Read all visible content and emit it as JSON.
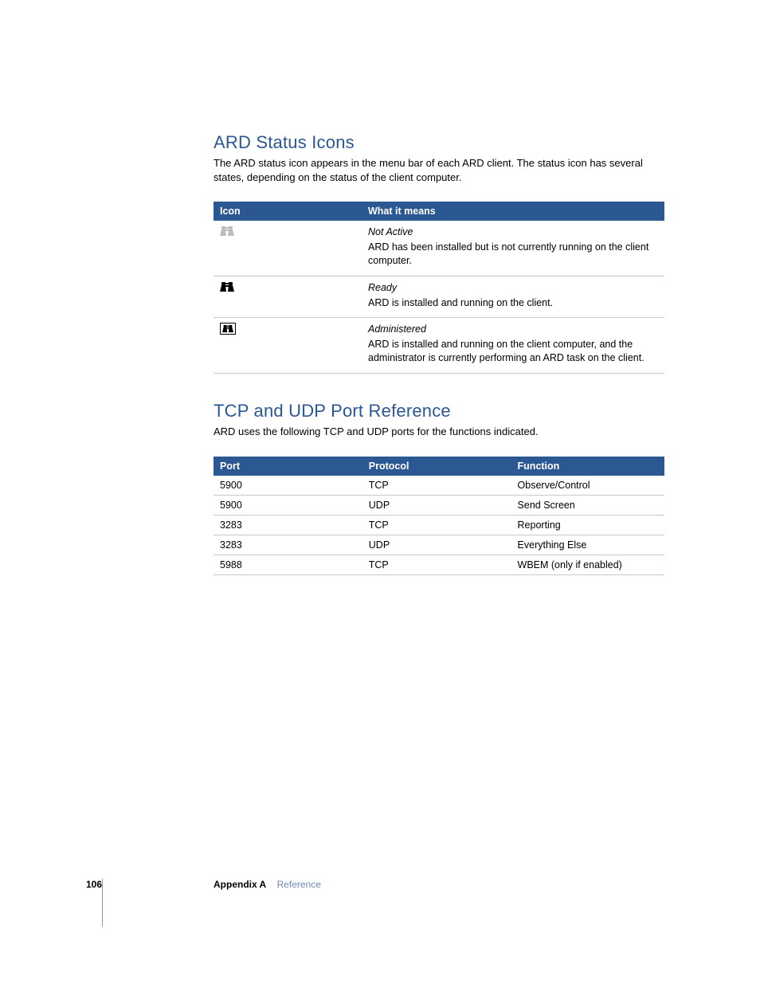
{
  "section1": {
    "heading": "ARD Status Icons",
    "intro": "The ARD status icon appears in the menu bar of each ARD client. The status icon has several states, depending on the status of the client computer.",
    "headers": {
      "c1": "Icon",
      "c2": "What it means"
    },
    "rows": [
      {
        "icon": "ard-inactive",
        "title": "Not Active",
        "desc": "ARD has been installed but is not currently running on the client computer."
      },
      {
        "icon": "ard-ready",
        "title": "Ready",
        "desc": "ARD is installed and running on the client."
      },
      {
        "icon": "ard-administered",
        "title": "Administered",
        "desc": "ARD is installed and running on the client computer, and the administrator is currently performing an ARD task on the client."
      }
    ]
  },
  "section2": {
    "heading": "TCP and UDP Port Reference",
    "intro": "ARD uses the following TCP and UDP ports for the functions indicated.",
    "headers": {
      "c1": "Port",
      "c2": "Protocol",
      "c3": "Function"
    },
    "rows": [
      {
        "port": "5900",
        "protocol": "TCP",
        "function": "Observe/Control"
      },
      {
        "port": "5900",
        "protocol": "UDP",
        "function": "Send Screen"
      },
      {
        "port": "3283",
        "protocol": "TCP",
        "function": "Reporting"
      },
      {
        "port": "3283",
        "protocol": "UDP",
        "function": "Everything Else"
      },
      {
        "port": "5988",
        "protocol": "TCP",
        "function": "WBEM (only if enabled)"
      }
    ]
  },
  "footer": {
    "page": "106",
    "appendix": "Appendix A",
    "title": "Reference"
  }
}
